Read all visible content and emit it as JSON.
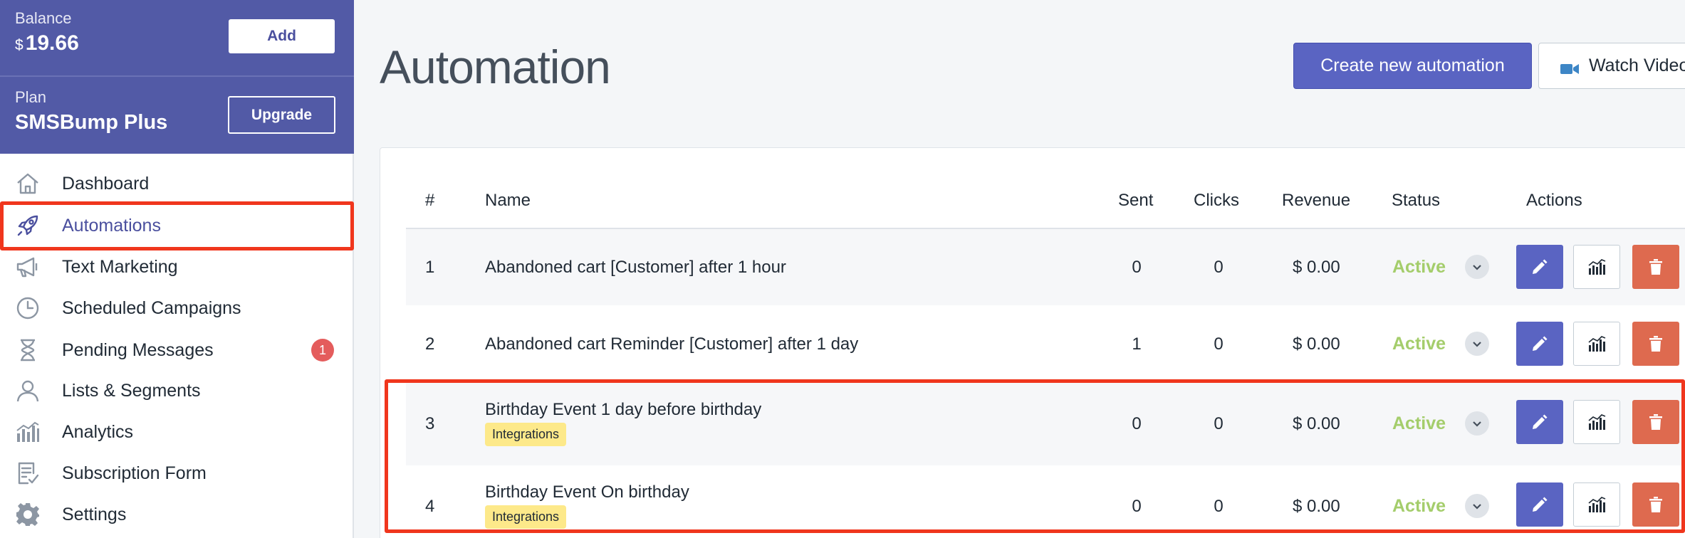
{
  "sidebar": {
    "balance": {
      "label": "Balance",
      "currency": "$",
      "amount": "19.66",
      "add_label": "Add"
    },
    "plan": {
      "label": "Plan",
      "name": "SMSBump Plus",
      "upgrade_label": "Upgrade"
    },
    "items": [
      {
        "label": "Dashboard",
        "icon": "home-icon"
      },
      {
        "label": "Automations",
        "icon": "rocket-icon",
        "active": true
      },
      {
        "label": "Text Marketing",
        "icon": "megaphone-icon"
      },
      {
        "label": "Scheduled Campaigns",
        "icon": "clock-icon"
      },
      {
        "label": "Pending Messages",
        "icon": "hourglass-icon",
        "badge": "1"
      },
      {
        "label": "Lists & Segments",
        "icon": "user-icon"
      },
      {
        "label": "Analytics",
        "icon": "bar-chart-icon"
      },
      {
        "label": "Subscription Form",
        "icon": "form-icon"
      },
      {
        "label": "Settings",
        "icon": "gear-icon"
      }
    ]
  },
  "header": {
    "title": "Automation",
    "create_label": "Create new automation",
    "watch_label": "Watch Video"
  },
  "table": {
    "columns": [
      "#",
      "Name",
      "Sent",
      "Clicks",
      "Revenue",
      "Status",
      "Actions"
    ],
    "rows": [
      {
        "num": "1",
        "name": "Abandoned cart [Customer] after 1 hour",
        "sent": "0",
        "clicks": "0",
        "revenue": "$ 0.00",
        "status": "Active"
      },
      {
        "num": "2",
        "name": "Abandoned cart Reminder [Customer] after 1 day",
        "sent": "1",
        "clicks": "0",
        "revenue": "$ 0.00",
        "status": "Active"
      },
      {
        "num": "3",
        "name": "Birthday Event 1 day before birthday",
        "tag": "Integrations",
        "sent": "0",
        "clicks": "0",
        "revenue": "$ 0.00",
        "status": "Active"
      },
      {
        "num": "4",
        "name": "Birthday Event On birthday",
        "tag": "Integrations",
        "sent": "0",
        "clicks": "0",
        "revenue": "$ 0.00",
        "status": "Active"
      }
    ]
  },
  "colors": {
    "brand": "#525aa6",
    "accent": "#5a64c2",
    "status_active": "#a4cd6b",
    "danger": "#de6a4f",
    "highlight": "#f0361d",
    "tag": "#fde98a"
  }
}
